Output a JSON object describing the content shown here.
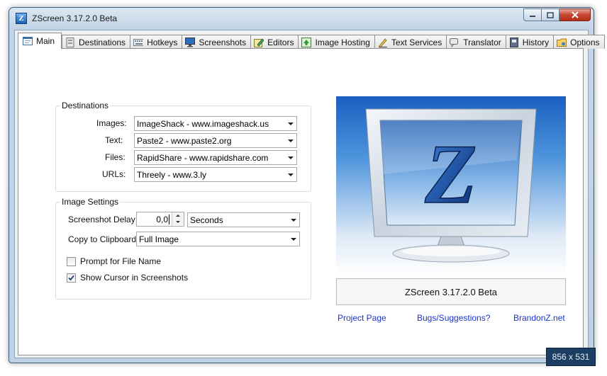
{
  "window": {
    "title": "ZScreen 3.17.2.0 Beta",
    "app_icon_letter": "Z"
  },
  "tabs": [
    {
      "label": "Main",
      "icon": "main-page-icon",
      "active": true
    },
    {
      "label": "Destinations",
      "icon": "destinations-icon",
      "active": false
    },
    {
      "label": "Hotkeys",
      "icon": "keyboard-icon",
      "active": false
    },
    {
      "label": "Screenshots",
      "icon": "monitor-icon",
      "active": false
    },
    {
      "label": "Editors",
      "icon": "editor-pencil-icon",
      "active": false
    },
    {
      "label": "Image Hosting",
      "icon": "image-upload-icon",
      "active": false
    },
    {
      "label": "Text Services",
      "icon": "text-pen-icon",
      "active": false
    },
    {
      "label": "Translator",
      "icon": "speech-bubble-icon",
      "active": false
    },
    {
      "label": "History",
      "icon": "history-book-icon",
      "active": false
    },
    {
      "label": "Options",
      "icon": "options-folder-icon",
      "active": false
    }
  ],
  "destinations": {
    "legend": "Destinations",
    "images_label": "Images:",
    "images_value": "ImageShack - www.imageshack.us",
    "text_label": "Text:",
    "text_value": "Paste2 - www.paste2.org",
    "files_label": "Files:",
    "files_value": "RapidShare - www.rapidshare.com",
    "urls_label": "URLs:",
    "urls_value": "Threely - www.3.ly"
  },
  "image_settings": {
    "legend": "Image Settings",
    "delay_label": "Screenshot Delay:",
    "delay_value": "0,0",
    "delay_unit": "Seconds",
    "clipboard_label": "Copy to Clipboard:",
    "clipboard_value": "Full Image",
    "prompt_label": "Prompt for File Name",
    "prompt_checked": false,
    "cursor_label": "Show Cursor in Screenshots",
    "cursor_checked": true
  },
  "about": {
    "logo_letter": "Z",
    "version_text": "ZScreen 3.17.2.0 Beta",
    "link_project": "Project Page",
    "link_bugs": "Bugs/Suggestions?",
    "link_site": "BrandonZ.net"
  },
  "overlay": {
    "size_badge": "856 x 531"
  },
  "colors": {
    "link": "#1a34c9",
    "logo_blue_dark": "#1a5fc0",
    "logo_blue_light": "#4f95dc",
    "close_button": "#c7452f"
  }
}
